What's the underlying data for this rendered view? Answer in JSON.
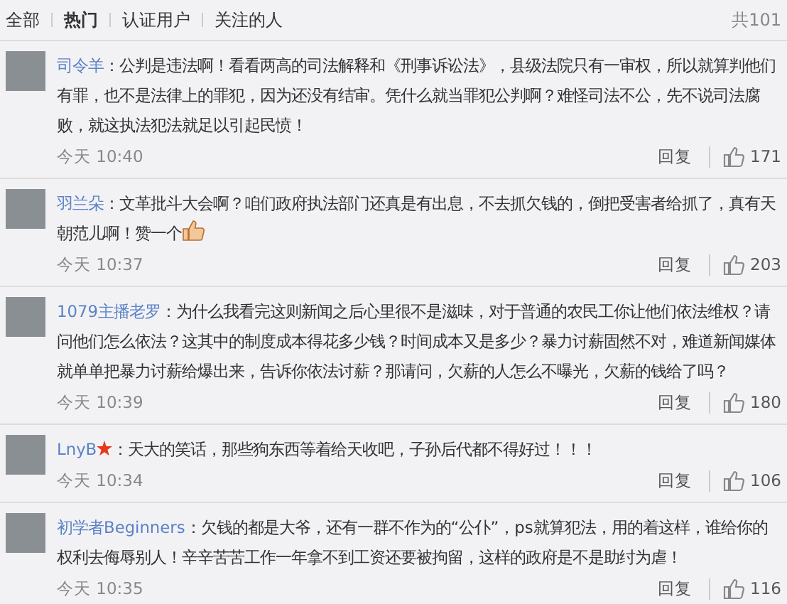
{
  "tabs": [
    {
      "label": "全部",
      "selected": false
    },
    {
      "label": "热门",
      "selected": true
    },
    {
      "label": "认证用户",
      "selected": false
    },
    {
      "label": "关注的人",
      "selected": false
    }
  ],
  "total": "共101",
  "comments": [
    {
      "user": "司令羊",
      "badge": false,
      "emoji": false,
      "text": "：公判是违法啊！看看两高的司法解释和《刑事诉讼法》，县级法院只有一审权，所以就算判他们有罪，也不是法律上的罪犯，因为还没有结审。凭什么就当罪犯公判啊？难怪司法不公，先不说司法腐败，就这执法犯法就足以引起民愤！",
      "time": "今天 10:40",
      "reply": "回复",
      "likes": "171"
    },
    {
      "user": "羽兰朵",
      "badge": false,
      "emoji": true,
      "text": "：文革批斗大会啊？咱们政府执法部门还真是有出息，不去抓欠钱的，倒把受害者给抓了，真有天朝范儿啊！赞一个",
      "time": "今天 10:37",
      "reply": "回复",
      "likes": "203"
    },
    {
      "user": "1079主播老罗",
      "badge": false,
      "emoji": false,
      "text": "：为什么我看完这则新闻之后心里很不是滋味，对于普通的农民工你让他们依法维权？请问他们怎么依法？这其中的制度成本得花多少钱？时间成本又是多少？暴力讨薪固然不对，难道新闻媒体就单单把暴力讨薪给爆出来，告诉你依法讨薪？那请问，欠薪的人怎么不曝光，欠薪的钱给了吗？",
      "time": "今天 10:39",
      "reply": "回复",
      "likes": "180"
    },
    {
      "user": "LnyB",
      "badge": true,
      "emoji": false,
      "text": "：天大的笑话，那些狗东西等着给天收吧，子孙后代都不得好过！！！",
      "time": "今天 10:34",
      "reply": "回复",
      "likes": "106"
    },
    {
      "user": "初学者Beginners",
      "badge": false,
      "emoji": false,
      "text": "：欠钱的都是大爷，还有一群不作为的“公仆”，ps就算犯法，用的着这样，谁给你的权利去侮辱别人！辛辛苦苦工作一年拿不到工资还要被拘留，这样的政府是不是助纣为虐！",
      "time": "今天 10:35",
      "reply": "回复",
      "likes": "116"
    }
  ]
}
